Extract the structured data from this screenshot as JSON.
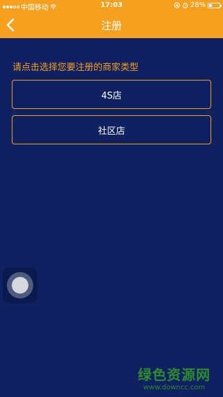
{
  "status_bar": {
    "carrier": "中国移动",
    "time": "17:03",
    "battery": "28%",
    "battery_level": 0.28
  },
  "nav": {
    "title": "注册"
  },
  "main": {
    "prompt": "请点击选择您要注册的商家类型",
    "options": [
      {
        "label": "4S店"
      },
      {
        "label": "社区店"
      }
    ]
  },
  "watermark": {
    "cn": "绿色资源网",
    "url": "www.downcc.com"
  },
  "colors": {
    "accent": "#f5a01e",
    "background": "#0f2160"
  }
}
